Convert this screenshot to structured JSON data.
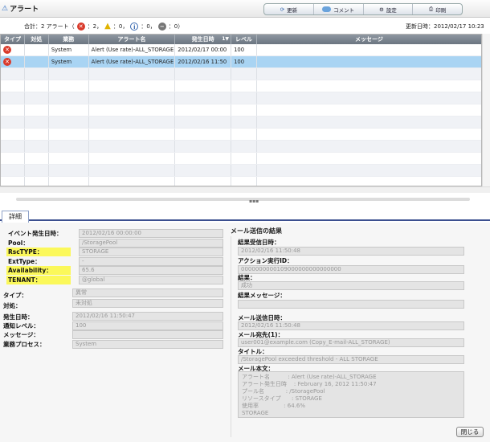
{
  "window": {
    "title": "アラート"
  },
  "toolbar": {
    "refresh": "更新",
    "comment": "コメント",
    "settings": "設定",
    "print": "印刷"
  },
  "summary": {
    "prefix": "合計：2 アラート（",
    "error_count": "：2，",
    "warning_count": "：0，",
    "info_count": "：0，",
    "unknown_count": "：0）"
  },
  "updated": {
    "label": "更新日時：",
    "value": "2012/02/17 10:23"
  },
  "grid": {
    "columns": [
      "タイプ",
      "対処",
      "業務",
      "アラート名",
      "発生日時",
      "レベル",
      "メッセージ"
    ],
    "sort_indicator": "1▼",
    "rows": [
      {
        "business": "System",
        "name": "Alert (Use rate)-ALL_STORAGE",
        "time": "2012/02/17 00:00",
        "level": "100"
      },
      {
        "business": "System",
        "name": "Alert (Use rate)-ALL_STORAGE",
        "time": "2012/02/16 11:50",
        "level": "100"
      }
    ]
  },
  "tabs": {
    "detail": "詳細"
  },
  "detail": {
    "event_time_label": "イベント発生日時：",
    "event_time": "2012/02/16 00:00:00",
    "pool_label": "Pool：",
    "pool": "/StoragePool",
    "rsctype_label": "RscTYPE：",
    "rsctype": "STORAGE",
    "exttype_label": "ExtType：",
    "exttype": "-",
    "availability_label": "Availability：",
    "availability": "65.6",
    "tenant_label": "TENANT：",
    "tenant": "@global",
    "type_label": "タイプ：",
    "type": "異常",
    "handling_label": "対処：",
    "handling": "未対処",
    "occurred_label": "発生日時：",
    "occurred": "2012/02/16 11:50:47",
    "notify_label": "通知レベル：",
    "notify": "100",
    "message_label": "メッセージ：",
    "message": "",
    "process_label": "業務プロセス：",
    "process": "System"
  },
  "mail": {
    "title": "メール送信の結果",
    "recv_time_label": "結果受信日時：",
    "recv_time": "2012/02/16 11:50:48",
    "action_id_label": "アクション実行ID：",
    "action_id": "0000000000109000000000000000",
    "result_label": "結果：",
    "result": "成功",
    "result_msg_label": "結果メッセージ：",
    "result_msg": "",
    "send_time_label": "メール送信日時：",
    "send_time": "2012/02/16 11:50:48",
    "to_label": "メール宛先(1)：",
    "to": "user001@example.com (Copy_E-mail-ALL_STORAGE)",
    "subject_label": "タイトル：",
    "subject": "/StoragePool exceeded threshold - ALL STORAGE",
    "body_label": "メール本文：",
    "body_lines": [
      "アラート名          : Alert (Use rate)-ALL_STORAGE",
      "アラート発生日時    : February 16, 2012 11:50:47",
      "プール名            : /StoragePool",
      "リソースタイプ      : STORAGE",
      "使用率              : 64.6%",
      "STORAGE"
    ]
  },
  "buttons": {
    "close": "閉じる"
  },
  "colors": {
    "header": "#6b7580",
    "selected_row": "#a9d4f3",
    "highlight": "#fbf85a",
    "error": "#d93a2b"
  }
}
